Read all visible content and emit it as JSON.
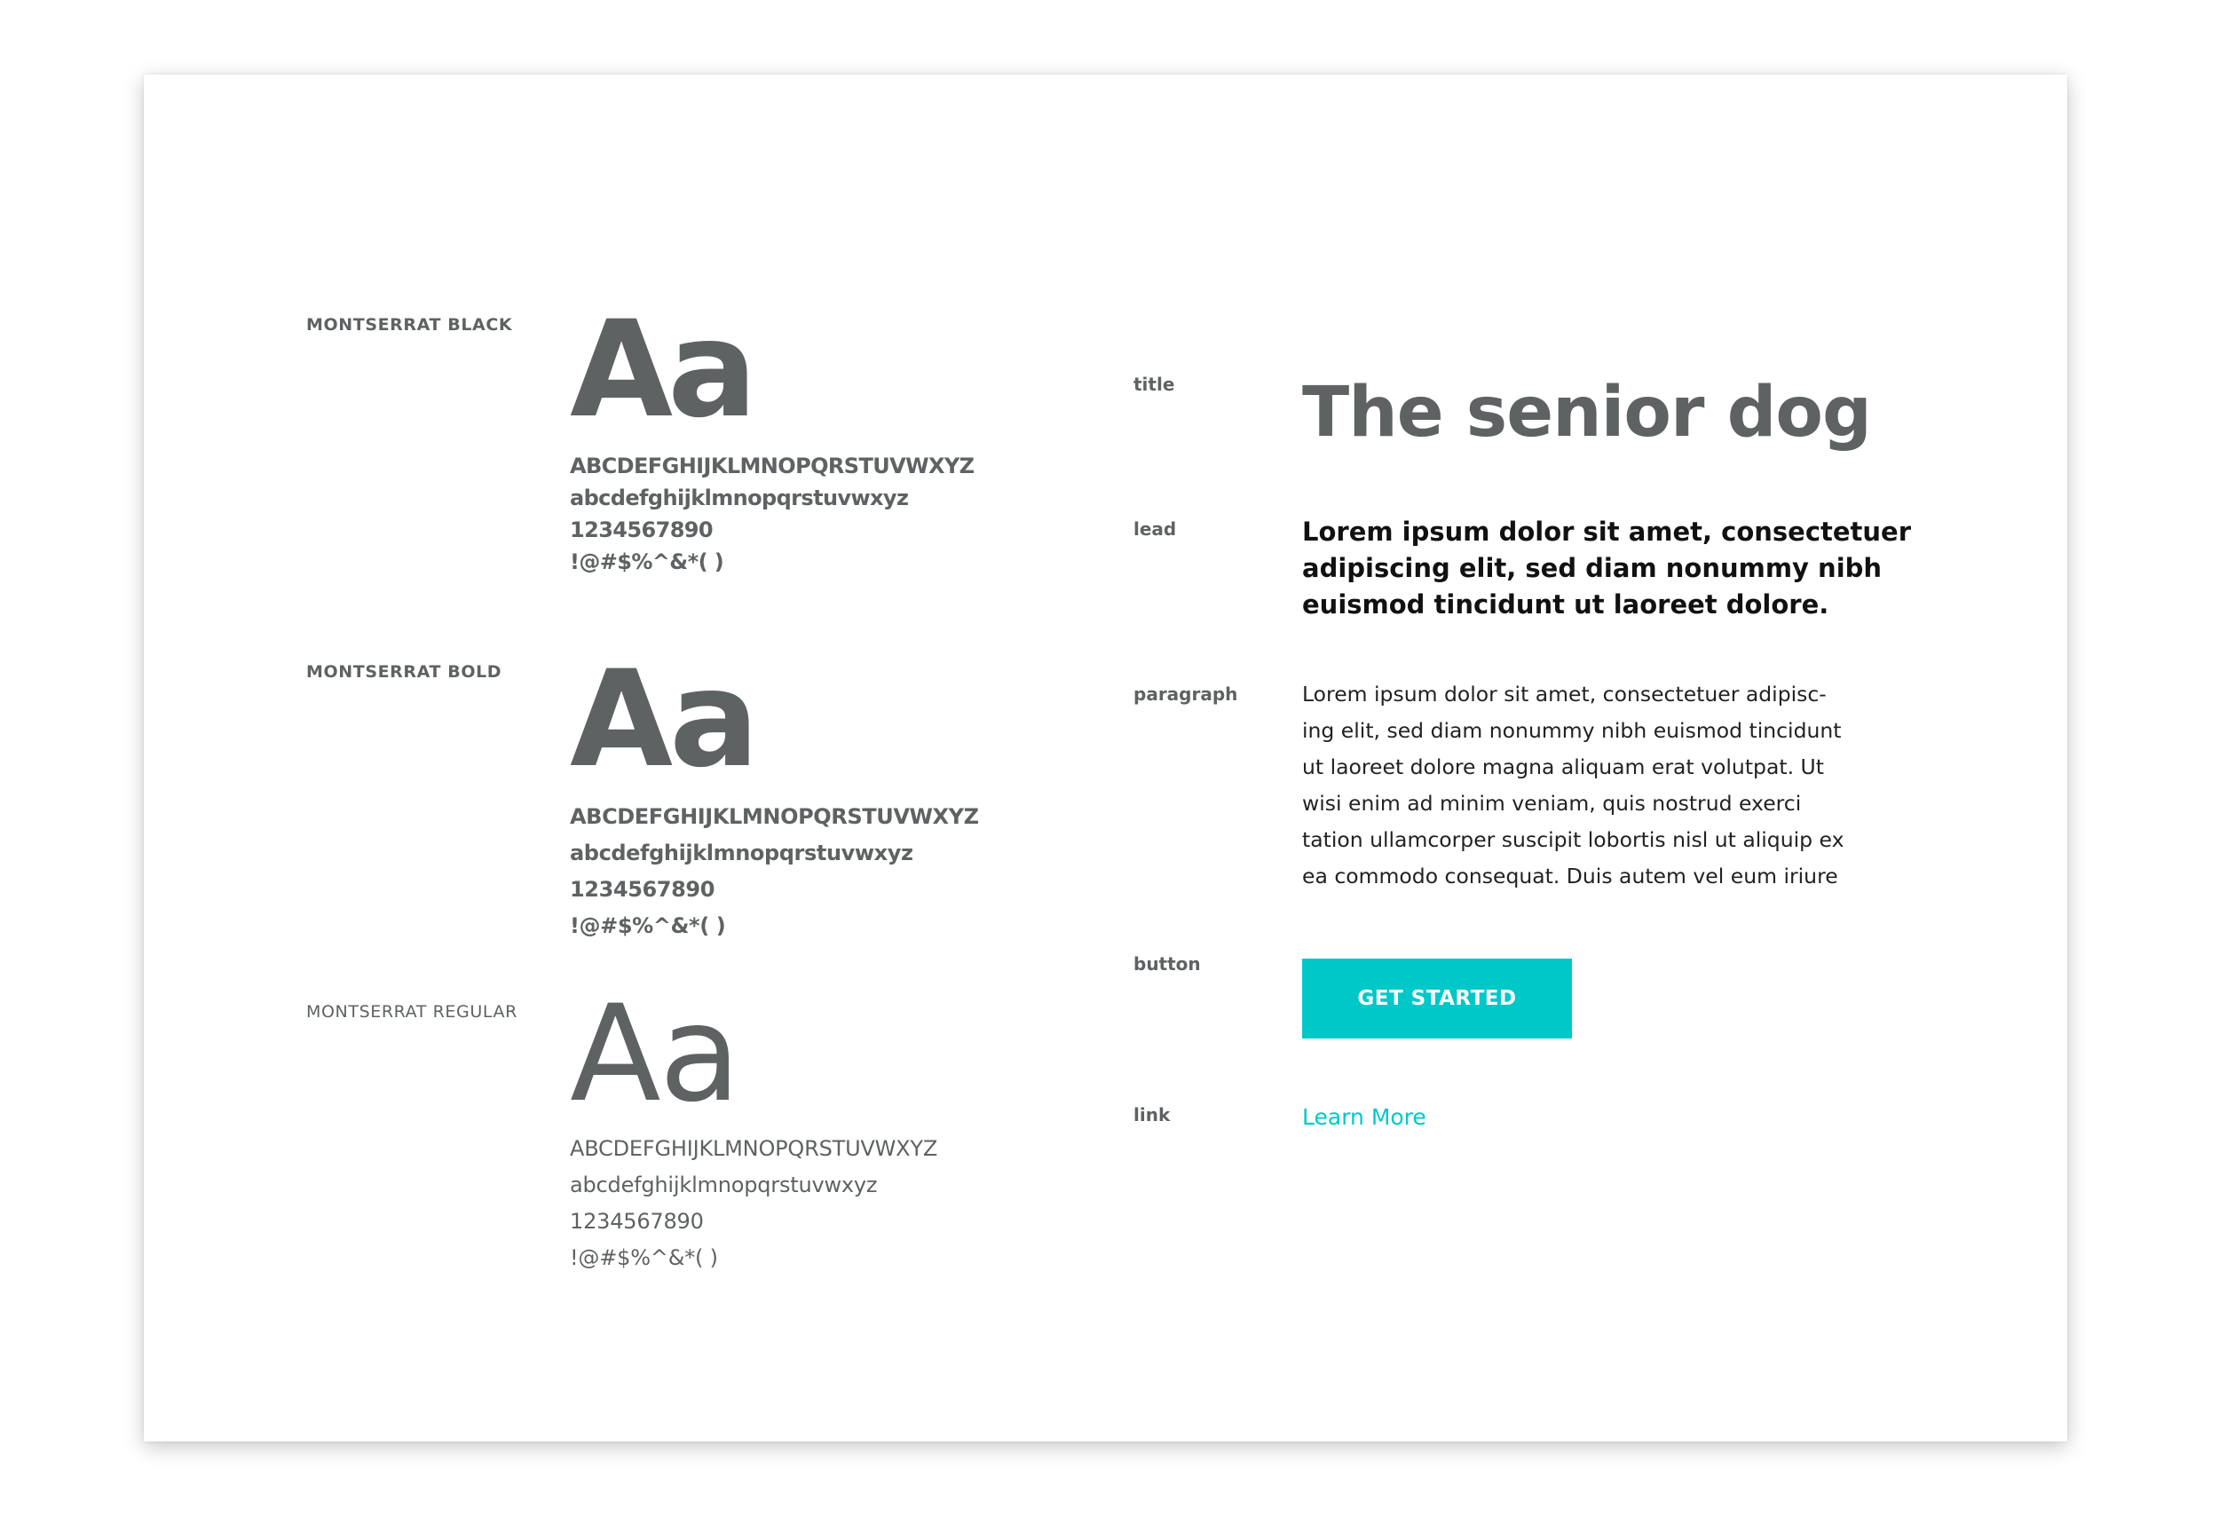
{
  "fonts": [
    {
      "label": "MONTSERRAT BLACK",
      "sample": "Aa",
      "uppercase": "ABCDEFGHIJKLMNOPQRSTUVWXYZ",
      "lowercase": "abcdefghijklmnopqrstuvwxyz",
      "digits": "1234567890",
      "symbols": "!@#$%^&*( )"
    },
    {
      "label": "MONTSERRAT BOLD",
      "sample": "Aa",
      "uppercase": "ABCDEFGHIJKLMNOPQRSTUVWXYZ",
      "lowercase": "abcdefghijklmnopqrstuvwxyz",
      "digits": "1234567890",
      "symbols": "!@#$%^&*( )"
    },
    {
      "label": "MONTSERRAT REGULAR",
      "sample": "Aa",
      "uppercase": "ABCDEFGHIJKLMNOPQRSTUVWXYZ",
      "lowercase": "abcdefghijklmnopqrstuvwxyz",
      "digits": "1234567890",
      "symbols": "!@#$%^&*( )"
    }
  ],
  "styles": {
    "title": {
      "label": "title",
      "text": "The senior dog"
    },
    "lead": {
      "label": "lead",
      "text": "Lorem ipsum dolor sit amet, consectetuer adipiscing elit, sed diam nonummy nibh euismod tincidunt ut laoreet dolore."
    },
    "paragraph": {
      "label": "paragraph",
      "lines": [
        "Lorem ipsum dolor sit amet, consectetuer adipisc-",
        "ing elit, sed diam nonummy nibh euismod tincidunt",
        "ut laoreet dolore magna aliquam erat volutpat. Ut",
        "wisi enim ad minim veniam, quis nostrud exerci",
        "tation ullamcorper suscipit lobortis nisl ut aliquip ex",
        "ea commodo consequat. Duis autem vel eum iriure"
      ]
    },
    "button": {
      "label": "button",
      "text": "GET STARTED"
    },
    "link": {
      "label": "link",
      "text": "Learn More"
    }
  },
  "colors": {
    "text_gray": "#5f6263",
    "accent": "#00c8c9",
    "lead_text": "#111111"
  }
}
